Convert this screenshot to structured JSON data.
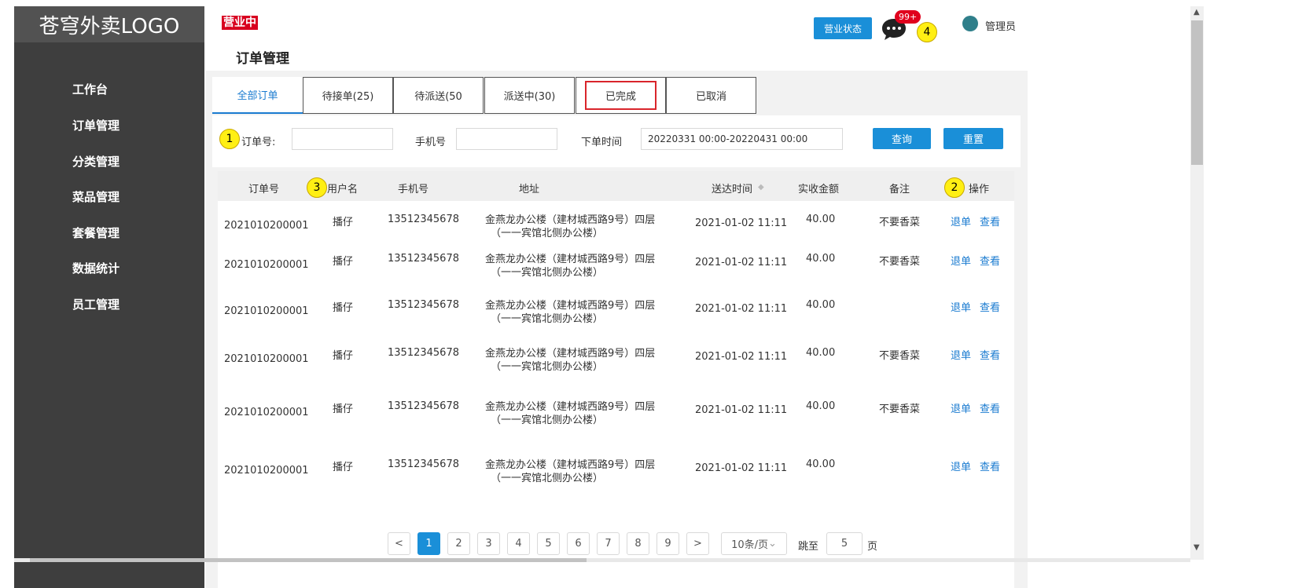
{
  "logo": "苍穹外卖LOGO",
  "sidebar": {
    "items": [
      {
        "label": "工作台"
      },
      {
        "label": "订单管理"
      },
      {
        "label": "分类管理"
      },
      {
        "label": "菜品管理"
      },
      {
        "label": "套餐管理"
      },
      {
        "label": "数据统计"
      },
      {
        "label": "员工管理"
      }
    ]
  },
  "header": {
    "business_status_tag": "营业中",
    "page_title": "订单管理",
    "status_button": "营业状态",
    "message_badge": "99+",
    "admin_name": "管理员"
  },
  "annotations": [
    "1",
    "2",
    "3",
    "4"
  ],
  "tabs": [
    {
      "label": "全部订单"
    },
    {
      "label": "待接单(25)"
    },
    {
      "label": "待派送(50"
    },
    {
      "label": "派送中(30)"
    },
    {
      "label": "已完成"
    },
    {
      "label": "已取消"
    }
  ],
  "filters": {
    "order_no_label": "订单号:",
    "order_no_value": "",
    "phone_label": "手机号",
    "phone_value": "",
    "time_label": "下单时间",
    "time_value": "20220331 00:00-20220431 00:00",
    "search_button": "查询",
    "reset_button": "重置"
  },
  "table": {
    "headers": [
      "订单号",
      "用户名",
      "手机号",
      "地址",
      "送达时间",
      "实收金额",
      "备注",
      "操作"
    ],
    "sort_icon": "sort-icon",
    "rows": [
      {
        "order_no": "2021010200001",
        "user": "播仔",
        "phone": "13512345678",
        "addr1": "金燕龙办公楼（建材城西路9号）四层",
        "addr2": "（一一宾馆北侧办公楼）",
        "time": "2021-01-02 11:11",
        "amount": "40.00",
        "note": "不要香菜",
        "refund": "退单",
        "view": "查看"
      },
      {
        "order_no": "2021010200001",
        "user": "播仔",
        "phone": "13512345678",
        "addr1": "金燕龙办公楼（建材城西路9号）四层",
        "addr2": "（一一宾馆北侧办公楼）",
        "time": "2021-01-02 11:11",
        "amount": "40.00",
        "note": "不要香菜",
        "refund": "退单",
        "view": "查看"
      },
      {
        "order_no": "2021010200001",
        "user": "播仔",
        "phone": "13512345678",
        "addr1": "金燕龙办公楼（建材城西路9号）四层",
        "addr2": "（一一宾馆北侧办公楼）",
        "time": "2021-01-02 11:11",
        "amount": "40.00",
        "note": "",
        "refund": "退单",
        "view": "查看"
      },
      {
        "order_no": "2021010200001",
        "user": "播仔",
        "phone": "13512345678",
        "addr1": "金燕龙办公楼（建材城西路9号）四层",
        "addr2": "（一一宾馆北侧办公楼）",
        "time": "2021-01-02 11:11",
        "amount": "40.00",
        "note": "不要香菜",
        "refund": "退单",
        "view": "查看"
      },
      {
        "order_no": "2021010200001",
        "user": "播仔",
        "phone": "13512345678",
        "addr1": "金燕龙办公楼（建材城西路9号）四层",
        "addr2": "（一一宾馆北侧办公楼）",
        "time": "2021-01-02 11:11",
        "amount": "40.00",
        "note": "不要香菜",
        "refund": "退单",
        "view": "查看"
      },
      {
        "order_no": "2021010200001",
        "user": "播仔",
        "phone": "13512345678",
        "addr1": "金燕龙办公楼（建材城西路9号）四层",
        "addr2": "（一一宾馆北侧办公楼）",
        "time": "2021-01-02 11:11",
        "amount": "40.00",
        "note": "",
        "refund": "退单",
        "view": "查看"
      }
    ]
  },
  "pagination": {
    "prev": "<",
    "pages": [
      "1",
      "2",
      "3",
      "4",
      "5",
      "6",
      "7",
      "8",
      "9"
    ],
    "next": ">",
    "current": "1",
    "page_size": "10条/页",
    "jump_label": "跳至",
    "jump_value": "5",
    "page_suffix": "页"
  },
  "colors": {
    "sidebar_bg": "#3e3e3e",
    "accent_blue": "#1a8fd8",
    "link_blue": "#1a7bd0",
    "status_red": "#d8001f",
    "highlight_red": "#d9252b",
    "marker_yellow": "#ffef14"
  }
}
